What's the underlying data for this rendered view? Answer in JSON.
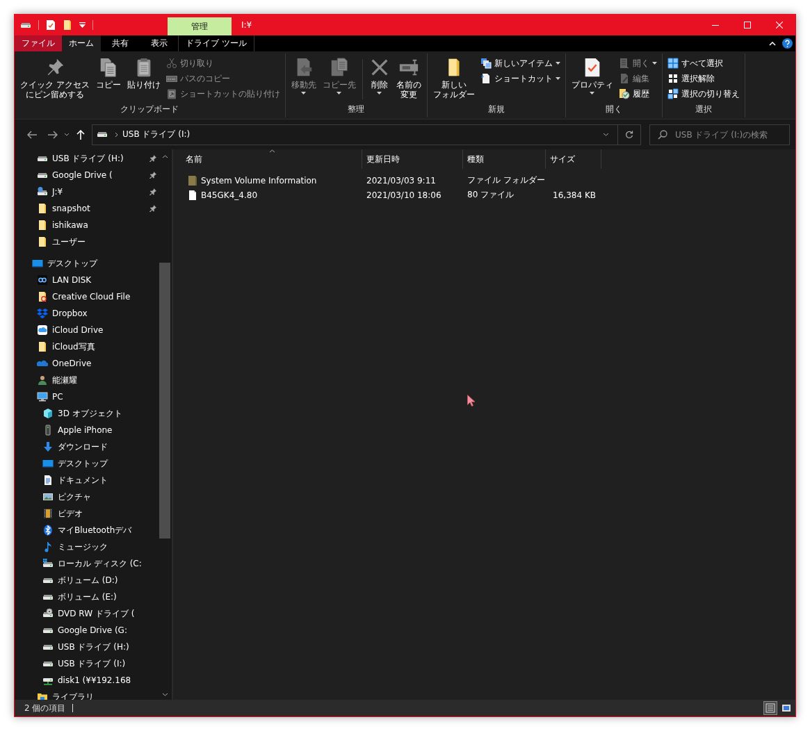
{
  "title_bar": {
    "context_tab": "管理",
    "title": "I:¥"
  },
  "ribbon_tabs": [
    {
      "label": "ファイル",
      "kind": "file",
      "selected": false
    },
    {
      "label": "ホーム",
      "kind": "tab",
      "selected": true
    },
    {
      "label": "共有",
      "kind": "tab",
      "selected": false
    },
    {
      "label": "表示",
      "kind": "tab",
      "selected": false
    },
    {
      "label": "ドライブ ツール",
      "kind": "context",
      "selected": false
    }
  ],
  "ribbon": {
    "groups": [
      {
        "label": "クリップボード",
        "commands": [
          {
            "kind": "large",
            "label": "クイック アクセスにピン留めする",
            "disabled": false,
            "has_menu": false
          },
          {
            "kind": "large",
            "label": "コピー",
            "disabled": false,
            "has_menu": false
          },
          {
            "kind": "large",
            "label": "貼り付け",
            "disabled": false,
            "has_menu": false
          },
          {
            "kind": "small",
            "label": "切り取り",
            "disabled": true,
            "has_menu": false
          },
          {
            "kind": "small",
            "label": "パスのコピー",
            "disabled": true,
            "has_menu": false
          },
          {
            "kind": "small",
            "label": "ショートカットの貼り付け",
            "disabled": true,
            "has_menu": false
          }
        ]
      },
      {
        "label": "整理",
        "commands": [
          {
            "kind": "large",
            "label": "移動先",
            "disabled": true,
            "has_menu": true
          },
          {
            "kind": "large",
            "label": "コピー先",
            "disabled": true,
            "has_menu": true
          },
          {
            "kind": "separator"
          },
          {
            "kind": "large",
            "label": "削除",
            "disabled": false,
            "has_menu": true
          },
          {
            "kind": "large",
            "label": "名前の変更",
            "disabled": false,
            "has_menu": false
          }
        ]
      },
      {
        "label": "新規",
        "commands": [
          {
            "kind": "large",
            "label": "新しいフォルダー",
            "disabled": false,
            "has_menu": false
          },
          {
            "kind": "small",
            "label": "新しいアイテム",
            "disabled": false,
            "has_menu": true
          },
          {
            "kind": "small",
            "label": "ショートカット",
            "disabled": false,
            "has_menu": true
          }
        ]
      },
      {
        "label": "開く",
        "commands": [
          {
            "kind": "large",
            "label": "プロパティ",
            "disabled": false,
            "has_menu": true
          },
          {
            "kind": "small",
            "label": "開く",
            "disabled": true,
            "has_menu": true
          },
          {
            "kind": "small",
            "label": "編集",
            "disabled": true,
            "has_menu": false
          },
          {
            "kind": "small",
            "label": "履歴",
            "disabled": false,
            "has_menu": false
          }
        ]
      },
      {
        "label": "選択",
        "commands": [
          {
            "kind": "small",
            "label": "すべて選択",
            "disabled": false,
            "has_menu": false
          },
          {
            "kind": "small",
            "label": "選択解除",
            "disabled": false,
            "has_menu": false
          },
          {
            "kind": "small",
            "label": "選択の切り替え",
            "disabled": false,
            "has_menu": false
          }
        ]
      }
    ]
  },
  "address_bar": {
    "segments": [
      "USB ドライブ (I:)"
    ]
  },
  "search": {
    "placeholder": "USB ドライブ (I:)の検索"
  },
  "sidebar": {
    "quick_access": [
      {
        "label": "USB ドライブ (H:)",
        "kind": "drive",
        "pinned": true
      },
      {
        "label": "Google Drive (",
        "kind": "drive",
        "pinned": true
      },
      {
        "label": "J:¥",
        "kind": "netdrive",
        "pinned": true
      },
      {
        "label": "snapshot",
        "kind": "folder",
        "pinned": true
      },
      {
        "label": "ishikawa",
        "kind": "folder",
        "pinned": false
      },
      {
        "label": "ユーザー",
        "kind": "folder",
        "pinned": false
      }
    ],
    "tree": [
      {
        "label": "デスクトップ",
        "kind": "desktop",
        "children": [
          {
            "label": "LAN DISK",
            "kind": "nas"
          },
          {
            "label": "Creative Cloud File",
            "kind": "ccfolder"
          },
          {
            "label": "Dropbox",
            "kind": "dropbox"
          },
          {
            "label": "iCloud Drive",
            "kind": "icloud"
          },
          {
            "label": "iCloud写真",
            "kind": "folder"
          },
          {
            "label": "OneDrive",
            "kind": "onedrive"
          },
          {
            "label": "能瀬耀",
            "kind": "user"
          },
          {
            "label": "PC",
            "kind": "pc",
            "children": [
              {
                "label": "3D オブジェクト",
                "kind": "cube"
              },
              {
                "label": "Apple iPhone",
                "kind": "phone"
              },
              {
                "label": "ダウンロード",
                "kind": "download"
              },
              {
                "label": "デスクトップ",
                "kind": "desktop"
              },
              {
                "label": "ドキュメント",
                "kind": "documents"
              },
              {
                "label": "ピクチャ",
                "kind": "pictures"
              },
              {
                "label": "ビデオ",
                "kind": "videos"
              },
              {
                "label": "マイBluetoothデバ",
                "kind": "bluetooth"
              },
              {
                "label": "ミュージック",
                "kind": "music"
              },
              {
                "label": "ローカル ディスク (C:",
                "kind": "sysdrive"
              },
              {
                "label": "ボリューム (D:)",
                "kind": "drive"
              },
              {
                "label": "ボリューム (E:)",
                "kind": "drive"
              },
              {
                "label": "DVD RW ドライブ (",
                "kind": "dvd"
              },
              {
                "label": "Google Drive (G:",
                "kind": "drive"
              },
              {
                "label": "USB ドライブ (H:)",
                "kind": "drive"
              },
              {
                "label": "USB ドライブ (I:)",
                "kind": "drive"
              },
              {
                "label": "disk1 (¥¥192.168",
                "kind": "share"
              }
            ]
          },
          {
            "label": "ライブラリ",
            "kind": "library"
          }
        ]
      }
    ]
  },
  "file_list": {
    "columns": [
      {
        "label": "名前",
        "sorted": true
      },
      {
        "label": "更新日時",
        "sorted": false
      },
      {
        "label": "種類",
        "sorted": false
      },
      {
        "label": "サイズ",
        "sorted": false
      }
    ],
    "rows": [
      {
        "kind": "folder",
        "name": "System Volume Information",
        "modified": "2021/03/03 9:11",
        "type": "ファイル フォルダー"
      },
      {
        "kind": "file",
        "name": "B45GK4_4.80",
        "modified": "2021/03/10 18:06",
        "type": "80 ファイル",
        "size": "16,384 KB"
      }
    ]
  },
  "status_bar": {
    "item_count": "2 個の項目",
    "view_buttons": [
      {
        "kind": "details",
        "selected": true
      },
      {
        "kind": "large-icons",
        "selected": false
      }
    ]
  }
}
